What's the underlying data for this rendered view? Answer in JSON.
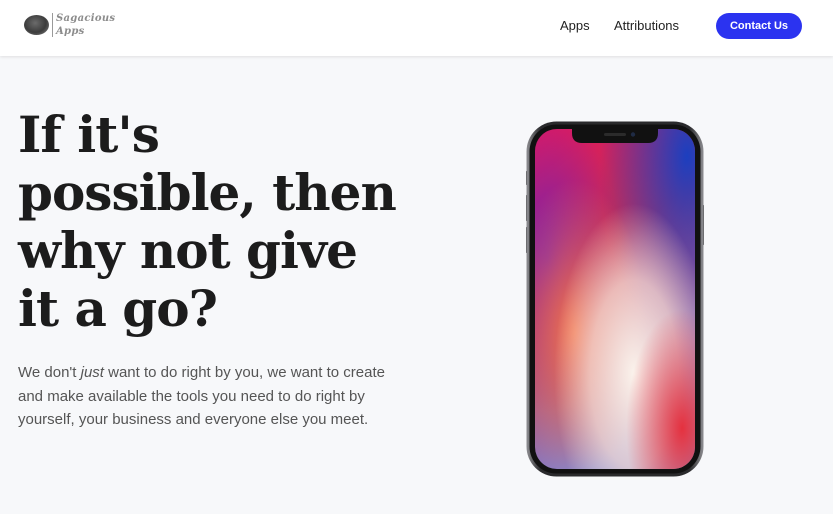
{
  "brand": {
    "line1": "Sagacious",
    "line2": "Apps"
  },
  "nav": {
    "apps": "Apps",
    "attributions": "Attributions",
    "cta": "Contact Us"
  },
  "hero": {
    "headline_lines": [
      "If it's",
      "possible, then",
      "why not give",
      "it a go?"
    ],
    "sub_before": "We don't ",
    "sub_emphasis": "just",
    "sub_after": " want to do right by you, we want to create and make available the tools you need to do right by yourself, your business and everyone else you meet."
  },
  "colors": {
    "accent": "#2b33f0",
    "background": "#f7f8fa",
    "headline": "#1c1c1c",
    "body_text": "#555555"
  },
  "icons": {
    "logo": "sagacious-logo-mark",
    "device": "smartphone-illustration"
  }
}
